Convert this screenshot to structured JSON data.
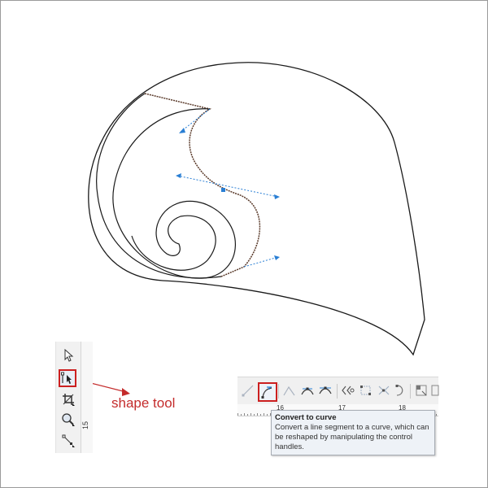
{
  "callout": {
    "label": "shape tool"
  },
  "toolbox": {
    "tools": [
      {
        "id": "pick",
        "icon": "pick-arrow-icon"
      },
      {
        "id": "shape",
        "icon": "shape-tool-icon",
        "selected": true
      },
      {
        "id": "crop",
        "icon": "crop-tool-icon"
      },
      {
        "id": "zoom",
        "icon": "zoom-tool-icon"
      },
      {
        "id": "freehand",
        "icon": "freehand-tool-icon"
      }
    ],
    "ruler_label": "15"
  },
  "property_bar": {
    "buttons": [
      {
        "id": "to-line",
        "icon": "convert-to-line-icon"
      },
      {
        "id": "to-curve",
        "icon": "convert-to-curve-icon",
        "selected": true
      },
      {
        "id": "cusp",
        "icon": "cusp-node-icon"
      },
      {
        "id": "smooth",
        "icon": "smooth-node-icon"
      },
      {
        "id": "symmetrical",
        "icon": "symmetrical-node-icon"
      },
      {
        "id": "reverse",
        "icon": "reverse-direction-icon"
      },
      {
        "id": "extend",
        "icon": "extend-curve-icon"
      },
      {
        "id": "extract",
        "icon": "extract-subpath-icon"
      },
      {
        "id": "close",
        "icon": "close-curve-icon"
      },
      {
        "id": "stretch",
        "icon": "stretch-nodes-icon"
      },
      {
        "id": "rotate",
        "icon": "rotate-nodes-icon"
      }
    ],
    "ruler_labels": [
      "16",
      "17",
      "18"
    ]
  },
  "tooltip": {
    "title": "Convert to curve",
    "line1": "Convert a line segment to a curve, which can",
    "line2": "be reshaped by manipulating the control",
    "line3": "handles."
  },
  "colors": {
    "outline": "#1a1a1a",
    "selected_curve": "#5a3a2a",
    "handle": "#2a7fd4",
    "highlight": "#cc2020"
  }
}
